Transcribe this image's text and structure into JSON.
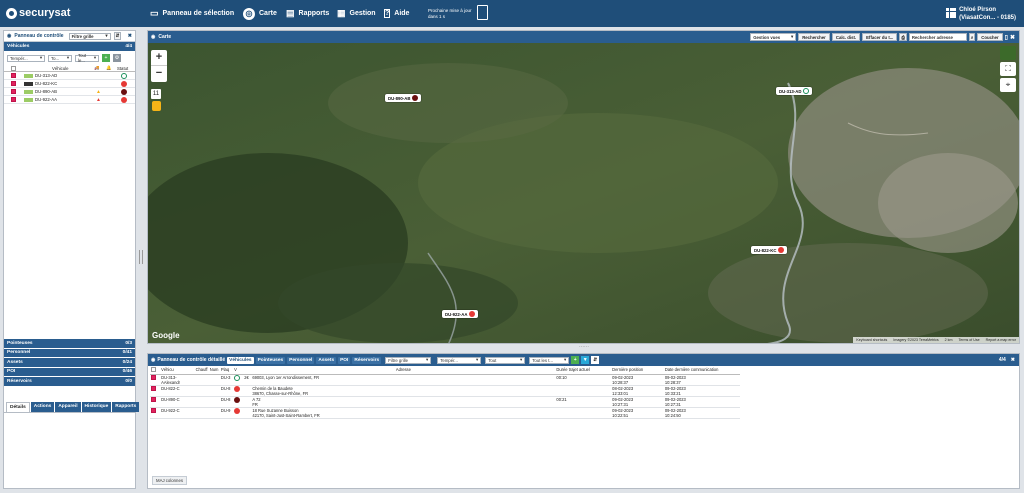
{
  "topbar": {
    "logo": "securysat",
    "nav": [
      {
        "label": "Panneau de sélection",
        "icon": "monitor-icon"
      },
      {
        "label": "Carte",
        "icon": "compass-icon"
      },
      {
        "label": "Rapports",
        "icon": "chart-icon"
      },
      {
        "label": "Gestion",
        "icon": "gear-icon"
      },
      {
        "label": "Aide",
        "icon": "help-icon"
      }
    ],
    "next_update_line1": "Prochaine mise à jour",
    "next_update_line2": "dans 1 s",
    "user_name": "Chloé Pirson",
    "user_org": "(ViasatCon... - 0185)"
  },
  "left_panel": {
    "title": "Panneau de contrôle",
    "filter_placeholder": "Filtre grille",
    "vehicles_label": "Véhicules",
    "vehicles_count": "4/4",
    "sel_temp": "Tempér...",
    "sel_type": "To...",
    "sel_all": "Tout le...",
    "col_vehicle": "Véhicule",
    "col_status": "Statut",
    "vehicles": [
      {
        "plate": "DU-313-AD",
        "status": "ok"
      },
      {
        "plate": "DU-822-KC",
        "status": "err"
      },
      {
        "plate": "DU-890-AB",
        "status": "dark"
      },
      {
        "plate": "DU-922-AA",
        "status": "err"
      }
    ],
    "sections": [
      {
        "label": "Pointeuses",
        "count": "0/3"
      },
      {
        "label": "Personnel",
        "count": "0/41"
      },
      {
        "label": "Assets",
        "count": "0/24"
      },
      {
        "label": "POI",
        "count": "0/46"
      },
      {
        "label": "Réservoirs",
        "count": "0/0"
      }
    ],
    "tabs": [
      "Détails",
      "Actions",
      "Appareil",
      "Historique",
      "Rapports"
    ]
  },
  "map": {
    "title": "Carte",
    "view_select": "Gestion vues",
    "buttons": [
      "Rechercher",
      "Calc. dist.",
      "Effacer du t..."
    ],
    "search_placeholder": "Rechercher adresse",
    "search_button": "Coucher",
    "markers": [
      {
        "plate": "DU-890-AB",
        "status": "dark"
      },
      {
        "plate": "DU-313-AD",
        "status": "ok"
      },
      {
        "plate": "DU-822-KC",
        "status": "err"
      },
      {
        "plate": "DU-922-AA",
        "status": "err"
      }
    ],
    "google": "Google",
    "attribution": [
      "Keyboard shortcuts",
      "Imagery ©2023 TerraMetrics",
      "2 km",
      "Terms of Use",
      "Report a map error"
    ],
    "scale_label": "11"
  },
  "bottom_panel": {
    "title": "Panneau de contrôle détaillé",
    "tabs": [
      "Véhicules",
      "Pointeuses",
      "Personnel",
      "Assets",
      "POI",
      "Réservoirs"
    ],
    "filter_placeholder": "Filtre grille",
    "sel_temp": "Tempér...",
    "sel_all1": "Tout",
    "sel_all2": "Tout les t...",
    "count": "4/4",
    "columns": [
      "",
      "Véhicu",
      "Chauff",
      "Num",
      "Plaq",
      "V",
      "",
      "Adresse",
      "Durée trajet actuel",
      "Dernière position",
      "Date dernière communication"
    ],
    "rows": [
      {
        "vehicle": "DU-313-AAlexandr",
        "plaque": "DU-3",
        "status": "ok",
        "v": "2€",
        "address1": "69003, Lyon 1er Arrondissement, FR",
        "address2": "",
        "duration": "00:10",
        "last_pos1": "09-02-2023",
        "last_pos2": "10:28:37",
        "last_comm1": "09-02-2023",
        "last_comm2": "10:28:37"
      },
      {
        "vehicle": "DU-822-C",
        "plaque": "DU-8",
        "status": "err",
        "v": "",
        "address1": "Chemin de la Baudete",
        "address2": "38670, Chasse-sur-Rhône, FR",
        "duration": "",
        "last_pos1": "08-02-2023",
        "last_pos2": "12:33:01",
        "last_comm1": "09-02-2023",
        "last_comm2": "10:33:21"
      },
      {
        "vehicle": "DU-890-C",
        "plaque": "DU-8",
        "status": "dark",
        "v": "",
        "address1": "A 72",
        "address2": "FR",
        "duration": "00:21",
        "last_pos1": "09-02-2023",
        "last_pos2": "10:27:31",
        "last_comm1": "09-02-2023",
        "last_comm2": "10:27:31"
      },
      {
        "vehicle": "DU-922-C",
        "plaque": "DU-9",
        "status": "err",
        "v": "",
        "address1": "18 Rue Suzanne Buisson",
        "address2": "42170, Saint-Just-Saint-Rambert, FR",
        "duration": "",
        "last_pos1": "09-02-2023",
        "last_pos2": "10:22:51",
        "last_comm1": "09-02-2023",
        "last_comm2": "10:24:50"
      }
    ],
    "footer": "MAJ colonnes"
  }
}
